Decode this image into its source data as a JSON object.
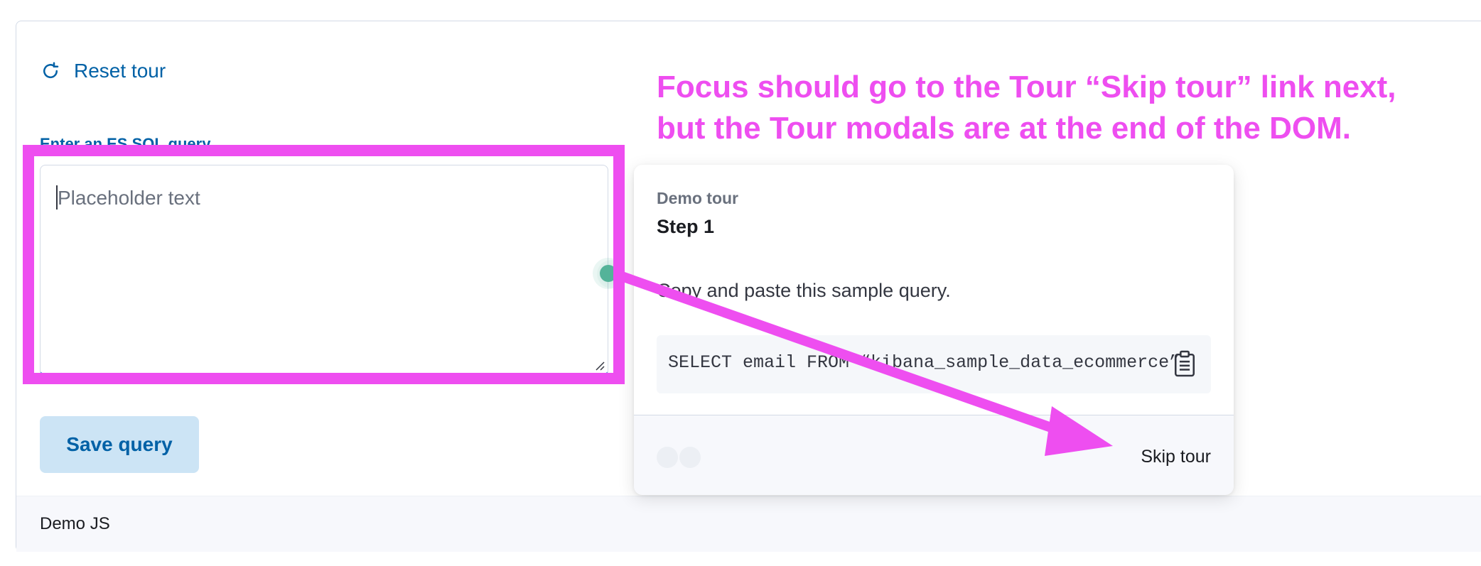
{
  "toolbar": {
    "reset_label": "Reset tour"
  },
  "form": {
    "label": "Enter an ES SQL query",
    "placeholder": "Placeholder text",
    "save_label": "Save query"
  },
  "footer": {
    "text": "Demo JS"
  },
  "tour": {
    "subtitle": "Demo tour",
    "title": "Step 1",
    "body": "Copy and paste this sample query.",
    "code": "SELECT email FROM “kibana_sample_data_ecommerce”",
    "skip_label": "Skip tour",
    "step_count": 2
  },
  "annotation": {
    "line1": "Focus should go to the Tour “Skip tour” link next,",
    "line2": "but the Tour modals are at the end of the DOM.",
    "color": "#EE4EF0"
  },
  "colors": {
    "link": "#0061A6",
    "beacon": "#54B399",
    "focus_underline": "#0B64DD"
  },
  "icons": {
    "reset": "refresh-icon",
    "copy": "clipboard-icon"
  }
}
